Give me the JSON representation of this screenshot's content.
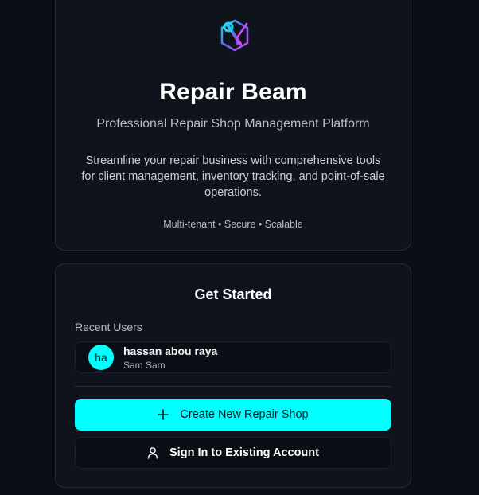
{
  "hero": {
    "title": "Repair Beam",
    "subtitle": "Professional Repair Shop Management Platform",
    "description": "Streamline your repair business with comprehensive tools for client management, inventory tracking, and point-of-sale operations.",
    "tags": "Multi-tenant • Secure • Scalable",
    "logo_icon": "wrench-hexagon-logo-icon"
  },
  "get_started": {
    "title": "Get Started",
    "recent_users_label": "Recent Users",
    "recent_users": [
      {
        "initials": "ha",
        "name": "hassan abou raya",
        "shop": "Sam Sam"
      }
    ],
    "create_button": {
      "label": "Create New Repair Shop",
      "icon": "plus-icon"
    },
    "signin_button": {
      "label": "Sign In to Existing Account",
      "icon": "user-icon"
    }
  },
  "colors": {
    "accent": "#00ffff",
    "background": "#0a0e15",
    "card": "#0f141c"
  }
}
